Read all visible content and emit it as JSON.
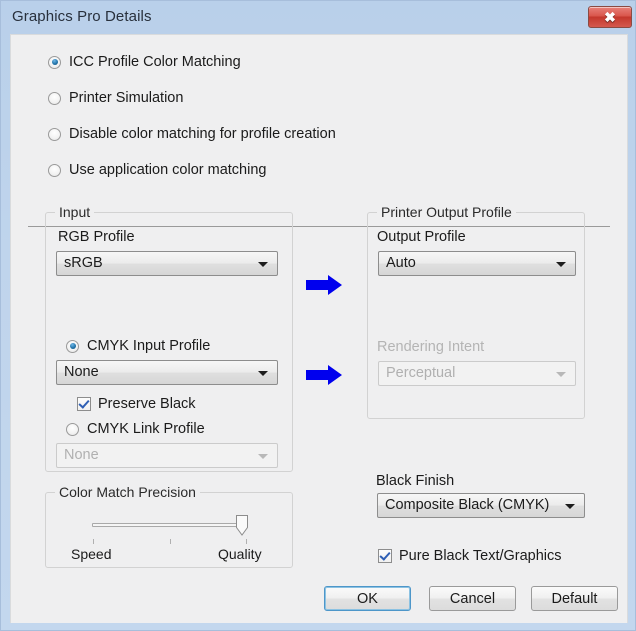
{
  "window": {
    "title": "Graphics Pro Details",
    "close_label": "✖"
  },
  "color_matching_modes": {
    "options": [
      {
        "label": "ICC Profile Color Matching",
        "selected": true,
        "enabled": true
      },
      {
        "label": "Printer Simulation",
        "selected": false,
        "enabled": true
      },
      {
        "label": "Disable color matching for profile creation",
        "selected": false,
        "enabled": true
      },
      {
        "label": "Use application color matching",
        "selected": false,
        "enabled": true
      }
    ]
  },
  "input_group": {
    "title": "Input",
    "rgb_profile_label": "RGB Profile",
    "rgb_profile_value": "sRGB",
    "cmyk_input_profile_label": "CMYK Input Profile",
    "cmyk_input_profile_value": "None",
    "preserve_black_label": "Preserve Black",
    "cmyk_link_profile_label": "CMYK Link Profile",
    "cmyk_link_profile_value": "None"
  },
  "precision_group": {
    "title": "Color Match Precision",
    "min_label": "Speed",
    "max_label": "Quality",
    "value_percent": 100
  },
  "output_group": {
    "title": "Printer Output Profile",
    "output_profile_label": "Output Profile",
    "output_profile_value": "Auto",
    "rendering_intent_label": "Rendering Intent",
    "rendering_intent_value": "Perceptual"
  },
  "black_finish": {
    "label": "Black Finish",
    "value": "Composite Black (CMYK)",
    "pure_black_label": "Pure Black Text/Graphics"
  },
  "buttons": {
    "ok": "OK",
    "cancel": "Cancel",
    "default": "Default"
  },
  "icons": {
    "flow_arrow": "right-arrow-icon",
    "close": "close-icon",
    "dropdown": "chevron-down-icon"
  },
  "colors": {
    "accent_arrow": "#0000ee",
    "titlebar": "#bfd4ec",
    "client_bg": "#efeff0",
    "close_button": "#d4594e"
  }
}
